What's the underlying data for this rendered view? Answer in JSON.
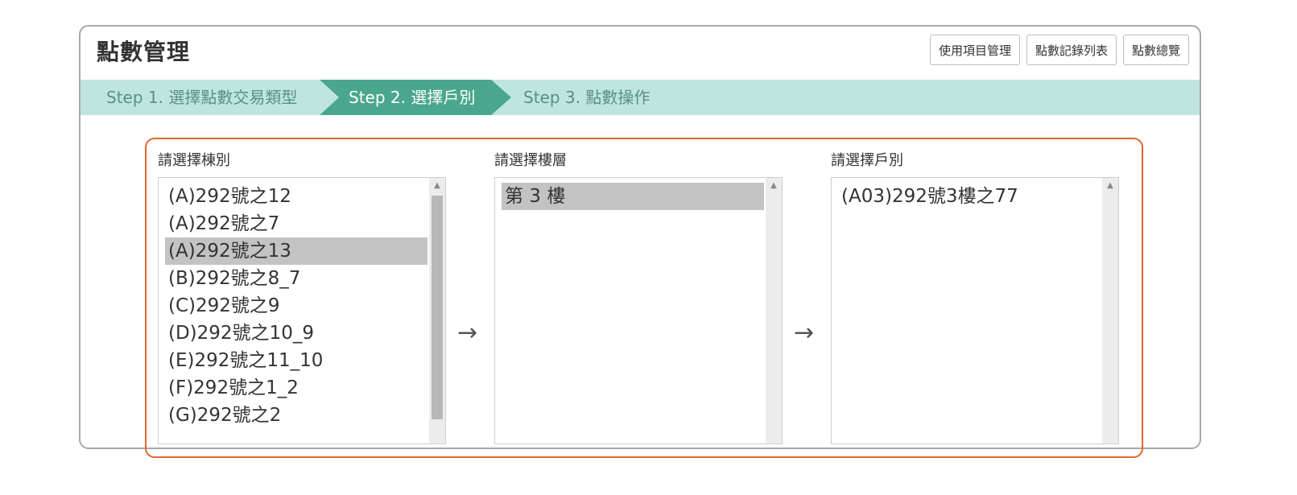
{
  "header": {
    "title": "點數管理",
    "buttons": [
      "使用項目管理",
      "點數記錄列表",
      "點數總覽"
    ]
  },
  "steps": [
    {
      "label": "Step 1. 選擇點數交易類型",
      "active": false
    },
    {
      "label": "Step 2. 選擇戶別",
      "active": true
    },
    {
      "label": "Step 3. 點數操作",
      "active": false
    }
  ],
  "columns": {
    "building": {
      "label": "請選擇棟別",
      "options": [
        "(A)292號之12",
        "(A)292號之7",
        "(A)292號之13",
        "(B)292號之8_7",
        "(C)292號之9",
        "(D)292號之10_9",
        "(E)292號之11_10",
        "(F)292號之1_2",
        "(G)292號之2"
      ],
      "selected": 2
    },
    "floor": {
      "label": "請選擇樓層",
      "options": [
        "第 3 樓"
      ],
      "selected": 0
    },
    "unit": {
      "label": "請選擇戶別",
      "options": [
        "(A03)292號3樓之77"
      ],
      "selected": -1
    }
  },
  "arrows": [
    "→",
    "→"
  ],
  "icons": {
    "scroll_up": "▲",
    "arrow": "arrow-right-icon"
  },
  "colors": {
    "active_step": "#4aa78d",
    "steps_bar": "#bfe5e1",
    "highlight_frame": "#e4652f",
    "selected_option": "#c3c3c3"
  }
}
